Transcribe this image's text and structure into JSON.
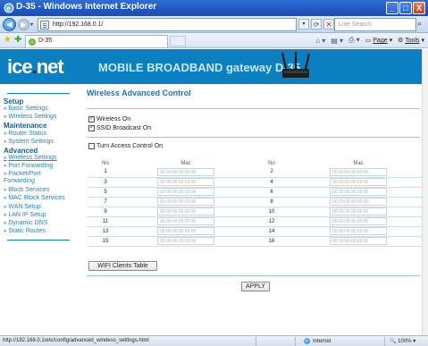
{
  "window": {
    "title": "D-35 - Windows Internet Explorer",
    "minimize": "_",
    "maximize": "□",
    "close": "X"
  },
  "addressbar": {
    "url": "http://192.168.0.1/",
    "search_placeholder": "Live Search"
  },
  "favbar": {
    "tab_label": "D-35",
    "commands": [
      "Page",
      "Tools"
    ]
  },
  "banner": {
    "logo": "ice",
    "logo_dot": ".",
    "logo_tail": "net",
    "title": "MOBILE BROADBAND gateway D-35"
  },
  "sidebar": {
    "sections": [
      {
        "title": "Setup",
        "items": [
          "Basic Settings",
          "Wireless Settings"
        ]
      },
      {
        "title": "Maintenance",
        "items": [
          "Router Status",
          "System Settings"
        ]
      },
      {
        "title": "Advanced",
        "items": [
          "Wireless Settings",
          "Port Forwarding",
          "Packet/Port Forwarding",
          "Block Services",
          "MAC Block Services",
          "WAN Setup",
          "LAN IP Setup",
          "Dynamic DNS",
          "Static Routes"
        ]
      }
    ]
  },
  "main": {
    "title": "Wireless Advanced Control",
    "wireless_on": "Wireless On",
    "ssid_broadcast": "SSID Broadcast On",
    "turn_access_control": "Turn Access Control On",
    "col_no": "No",
    "col_mac": "Mac",
    "mac_placeholder": "00:00:00:00:00:00",
    "rows": [
      {
        "left": "1",
        "right": "2"
      },
      {
        "left": "3",
        "right": "4"
      },
      {
        "left": "5",
        "right": "6"
      },
      {
        "left": "7",
        "right": "8"
      },
      {
        "left": "9",
        "right": "10"
      },
      {
        "left": "11",
        "right": "12"
      },
      {
        "left": "13",
        "right": "14"
      },
      {
        "left": "15",
        "right": "16"
      }
    ],
    "wifi_clients_button": "WIFI Clients Table",
    "apply_button": "APPLY"
  },
  "status": {
    "text": "http://192.168.0.1/etc/config/advanced_wireless_settings.html",
    "zone": "Internet",
    "zoom": "100%"
  }
}
